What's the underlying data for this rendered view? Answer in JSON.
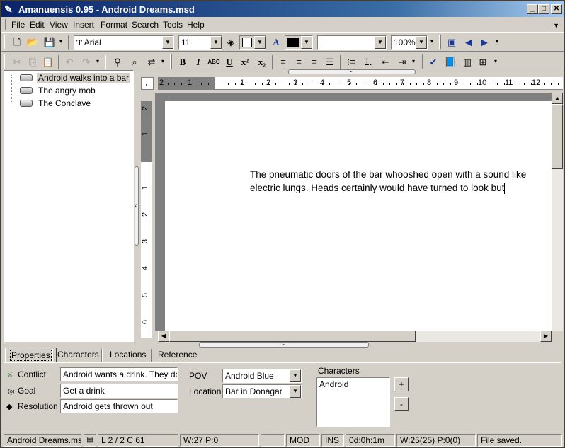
{
  "window": {
    "title": "Amanuensis 0.95 - Android Dreams.msd"
  },
  "menu": [
    "File",
    "Edit",
    "View",
    "Insert",
    "Format",
    "Search",
    "Tools",
    "Help"
  ],
  "format_bar": {
    "font": "Arial",
    "font_prefix": "T",
    "size": "11",
    "zoom": "100%"
  },
  "format_buttons": {
    "bold": "B",
    "italic": "I",
    "underline": "U"
  },
  "tree": {
    "items": [
      {
        "label": "Android walks into a bar",
        "selected": true
      },
      {
        "label": "The angry mob",
        "selected": false
      },
      {
        "label": "The Conclave",
        "selected": false
      }
    ]
  },
  "ruler": {
    "h_labels": [
      "2",
      "1",
      "1",
      "2",
      "3",
      "4",
      "5",
      "6",
      "7",
      "8",
      "9",
      "10",
      "11",
      "12"
    ],
    "v_labels": [
      "2",
      "1",
      "1",
      "2",
      "3",
      "4",
      "5",
      "6"
    ]
  },
  "document": {
    "text": "The pneumatic doors of the bar whooshed open with a sound like electric lungs. Heads certainly would have turned to look but"
  },
  "tabs": [
    "Properties",
    "Characters",
    "Locations",
    "Reference"
  ],
  "properties": {
    "conflict_label": "Conflict",
    "conflict_value": "Android wants a drink. They don't",
    "goal_label": "Goal",
    "goal_value": "Get a drink",
    "resolution_label": "Resolution",
    "resolution_value": "Android gets thrown out",
    "pov_label": "POV",
    "pov_value": "Android Blue",
    "location_label": "Location",
    "location_value": "Bar in Donagar",
    "characters_label": "Characters",
    "characters": [
      "Android"
    ],
    "add_label": "+",
    "remove_label": "-"
  },
  "status": {
    "file": "Android Dreams.msd",
    "position": "L 2 / 2  C 61",
    "words": "W:27  P:0",
    "mod": "MOD",
    "ins": "INS",
    "time": "0d:0h:1m",
    "total": "W:25(25)  P:0(0)",
    "message": "File saved."
  }
}
